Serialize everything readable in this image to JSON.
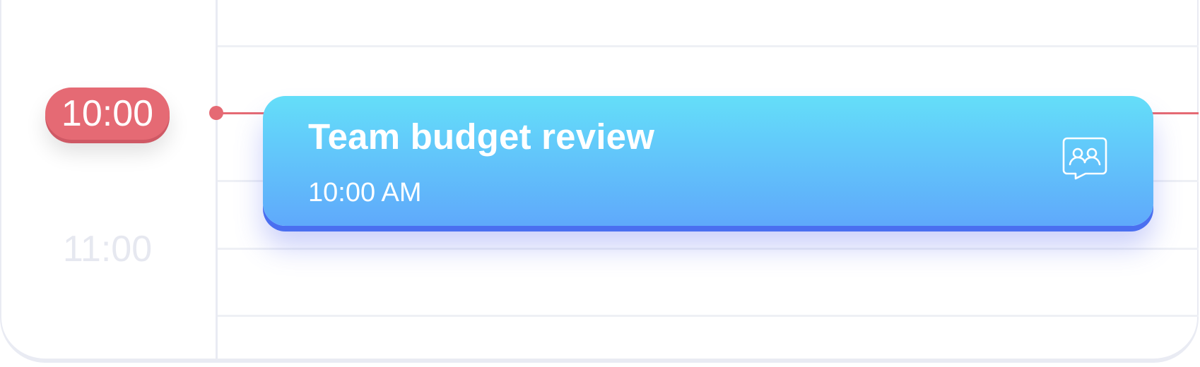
{
  "timeline": {
    "current_time": "10:00",
    "hours": [
      "11:00"
    ]
  },
  "event": {
    "title": "Team budget review",
    "time": "10:00 AM",
    "icon": "meeting-chat-icon"
  },
  "colors": {
    "now_indicator": "#e56a74",
    "event_gradient_top": "#64def9",
    "event_gradient_bottom": "#5fa9fb",
    "event_accent": "#4a6ff0",
    "muted_hour": "#e6e8f0"
  }
}
